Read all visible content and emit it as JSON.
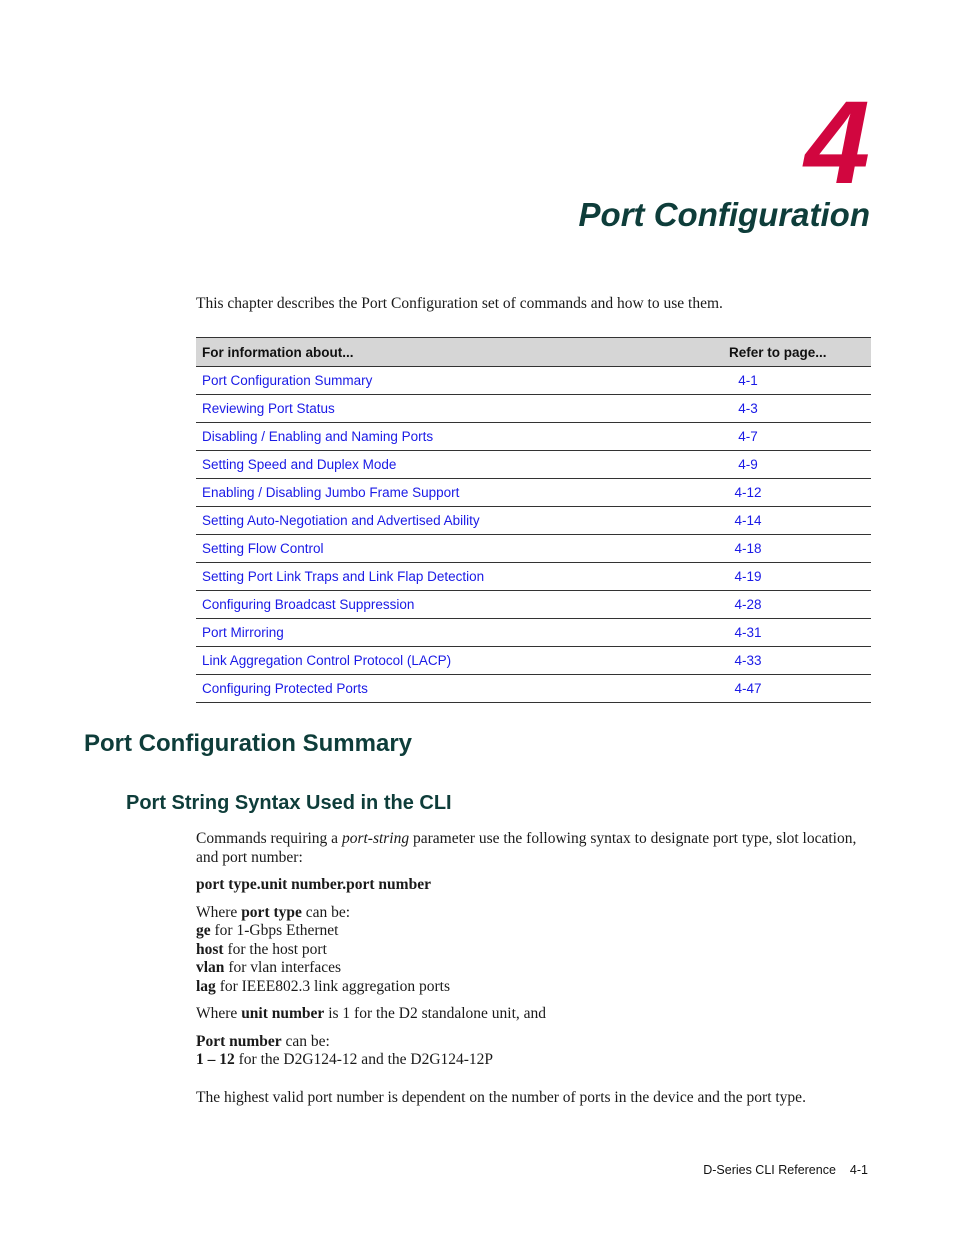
{
  "chapter": {
    "number": "4",
    "title": "Port Configuration"
  },
  "intro": "This chapter describes the Port Configuration set of commands and how to use them.",
  "toc": {
    "header_topic": "For information about...",
    "header_page": "Refer to page...",
    "rows": [
      {
        "topic": "Port Configuration Summary",
        "page": "4-1"
      },
      {
        "topic": "Reviewing Port Status",
        "page": "4-3"
      },
      {
        "topic": "Disabling / Enabling and Naming Ports",
        "page": "4-7"
      },
      {
        "topic": "Setting Speed and Duplex Mode",
        "page": "4-9"
      },
      {
        "topic": "Enabling / Disabling Jumbo Frame Support",
        "page": "4-12"
      },
      {
        "topic": "Setting Auto-Negotiation and Advertised Ability",
        "page": "4-14"
      },
      {
        "topic": "Setting Flow Control",
        "page": "4-18"
      },
      {
        "topic": "Setting Port Link Traps and Link Flap Detection",
        "page": "4-19"
      },
      {
        "topic": "Configuring Broadcast Suppression",
        "page": "4-28"
      },
      {
        "topic": "Port Mirroring",
        "page": "4-31"
      },
      {
        "topic": "Link Aggregation Control Protocol (LACP)",
        "page": "4-33"
      },
      {
        "topic": "Configuring Protected Ports",
        "page": "4-47"
      }
    ]
  },
  "section": {
    "title": "Port Configuration Summary",
    "subsection": {
      "title": "Port String Syntax Used in the CLI",
      "p1_a": "Commands requiring a ",
      "p1_em": "port-string",
      "p1_b": " parameter use the following syntax to designate port type, slot location, and port number:",
      "syntax": "port type.unit number.port number",
      "where_a": "Where ",
      "where_bold": "port type",
      "where_b": " can be:",
      "port_types": [
        {
          "name": "ge",
          "desc": " for 1-Gbps Ethernet"
        },
        {
          "name": "host",
          "desc": " for the host port"
        },
        {
          "name": "vlan",
          "desc": " for vlan interfaces"
        },
        {
          "name": "lag",
          "desc": " for IEEE802.3 link aggregation ports"
        }
      ],
      "unit_a": "Where ",
      "unit_bold": "unit number",
      "unit_b": " is 1 for the D2 standalone unit, and",
      "portnum_bold": "Port number",
      "portnum_b": " can be:",
      "range_bold": "1 – 12",
      "range_b": " for the D2G124-12 and the D2G124-12P",
      "closing": "The highest valid port number is dependent on the number of ports in the device and the port type."
    }
  },
  "footer": {
    "title": "D-Series CLI Reference",
    "page": "4-1"
  },
  "colors": {
    "chapter_number": "#d1063f",
    "heading": "#0e3d3a",
    "link": "#1a1ae6"
  }
}
